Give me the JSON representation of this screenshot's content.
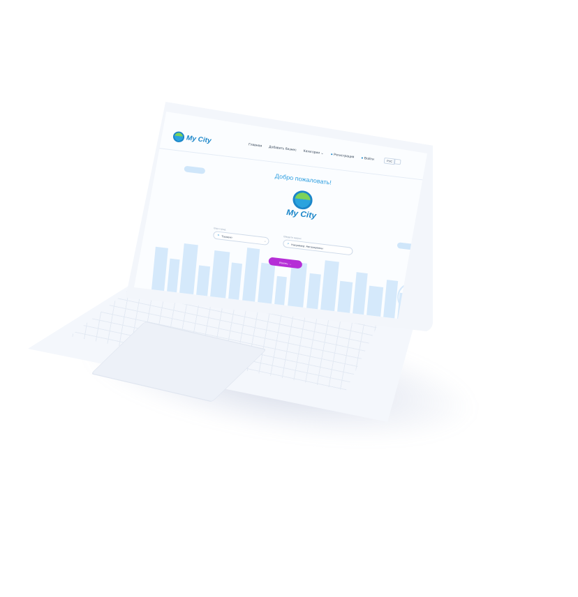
{
  "app": {
    "logo_text": "My City",
    "nav": [
      {
        "label": "Главная"
      },
      {
        "label": "Добавить бизнес"
      },
      {
        "label": "Категории"
      }
    ],
    "register_label": "Регистрация",
    "login_label": "Войти",
    "language": "РУС"
  },
  "hero": {
    "welcome": "Добро пожаловать!",
    "logo_text": "My City"
  },
  "search": {
    "city_label": "Ваш город",
    "city_value": "Ташкент",
    "query_label": "Введите запрос",
    "query_placeholder": "Например: Автосервисы",
    "button_label": "Искать →"
  },
  "colors": {
    "brand_blue": "#1b86c9",
    "sky_blue": "#2f9fe0",
    "button_purple": "#b52ed6",
    "grass_green": "#6cc24a",
    "building_blue": "#cfe6fa"
  },
  "icons": [
    "location-pin-icon",
    "search-icon",
    "user-icon",
    "chevron-down-icon",
    "menu-icon"
  ]
}
